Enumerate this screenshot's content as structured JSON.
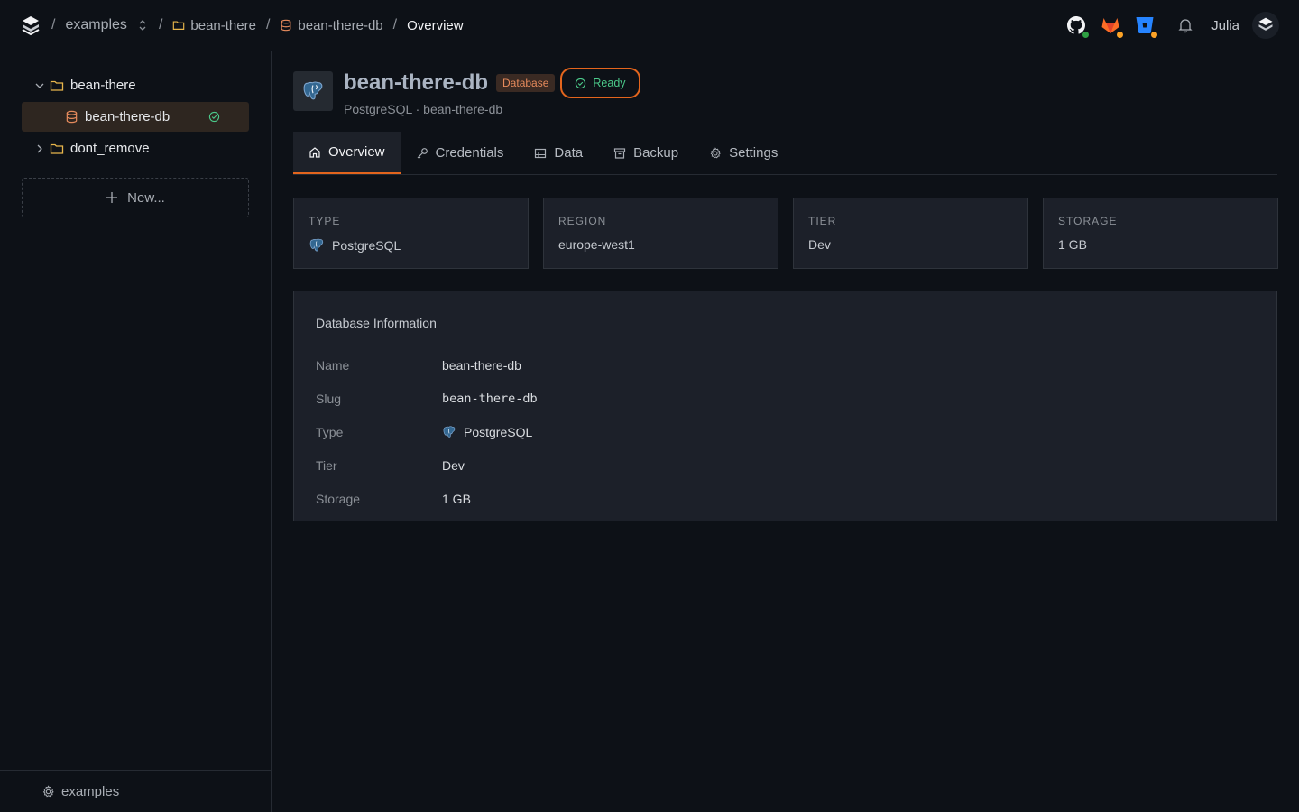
{
  "breadcrumb": {
    "project": "examples",
    "folder": "bean-there",
    "database": "bean-there-db",
    "current": "Overview"
  },
  "user": {
    "name": "Julia"
  },
  "sidebar": {
    "tree": [
      {
        "label": "bean-there",
        "type": "folder",
        "expanded": true
      },
      {
        "label": "bean-there-db",
        "type": "database",
        "status": "ready",
        "selected": true
      },
      {
        "label": "dont_remove",
        "type": "folder",
        "expanded": false
      }
    ],
    "new_label": "New...",
    "footer_label": "examples"
  },
  "header": {
    "title": "bean-there-db",
    "type_badge": "Database",
    "status_badge": "Ready",
    "subtitle": "PostgreSQL · bean-there-db"
  },
  "tabs": [
    {
      "label": "Overview",
      "icon": "home-icon",
      "active": true
    },
    {
      "label": "Credentials",
      "icon": "key-icon",
      "active": false
    },
    {
      "label": "Data",
      "icon": "table-icon",
      "active": false
    },
    {
      "label": "Backup",
      "icon": "archive-icon",
      "active": false
    },
    {
      "label": "Settings",
      "icon": "gear-icon",
      "active": false
    }
  ],
  "stats": [
    {
      "label": "TYPE",
      "value": "PostgreSQL",
      "icon": "postgres-icon"
    },
    {
      "label": "REGION",
      "value": "europe-west1"
    },
    {
      "label": "TIER",
      "value": "Dev"
    },
    {
      "label": "STORAGE",
      "value": "1 GB"
    }
  ],
  "info": {
    "title": "Database Information",
    "rows": [
      {
        "key": "Name",
        "value": "bean-there-db"
      },
      {
        "key": "Slug",
        "value": "bean-there-db"
      },
      {
        "key": "Type",
        "value": "PostgreSQL"
      },
      {
        "key": "Tier",
        "value": "Dev"
      },
      {
        "key": "Storage",
        "value": "1 GB"
      }
    ]
  },
  "colors": {
    "accent": "#e3651d",
    "ready": "#4bc98a",
    "folder": "#e8b64b",
    "database": "#e58a5c",
    "github_dot": "#2ea043",
    "gitlab": "#fc6d26",
    "bitbucket": "#2684ff"
  }
}
